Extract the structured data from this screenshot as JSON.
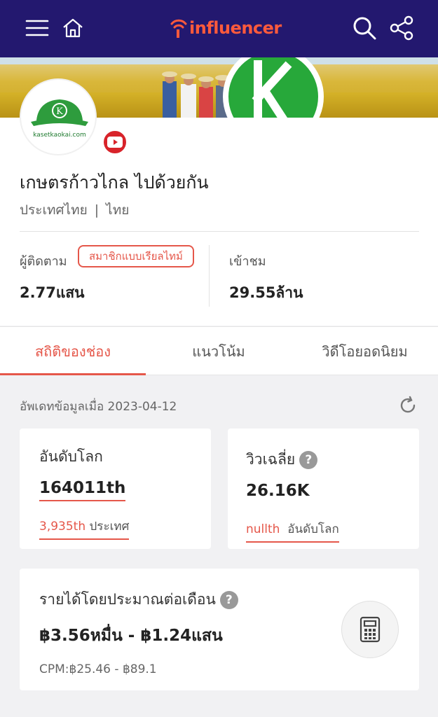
{
  "header": {
    "logo_text": "influencer",
    "brand_color": "#ff5a3c",
    "bar_color": "#23186f"
  },
  "channel": {
    "avatar_caption": "kasetkaokai.com",
    "platform_icon": "youtube-icon",
    "name": "เกษตรก้าวไกล ไปด้วยกัน",
    "country": "ประเทศไทย",
    "separator": "|",
    "language": "ไทย"
  },
  "stats": {
    "followers_label": "ผู้ติดตาม",
    "realtime_badge": "สมาชิกแบบเรียลไทม์",
    "followers_value": "2.77แสน",
    "views_label": "เข้าชม",
    "views_value": "29.55ล้าน"
  },
  "tabs": [
    {
      "label": "สถิติของช่อง",
      "active": true
    },
    {
      "label": "แนวโน้ม",
      "active": false
    },
    {
      "label": "วิดีโอยอดนิยม",
      "active": false
    }
  ],
  "updated_text": "อัพเดทข้อมูลเมื่อ 2023-04-12",
  "world_rank": {
    "title": "อันดับโลก",
    "value": "164011th",
    "country_rank": "3,935th",
    "country_rank_label": "ประเทศ"
  },
  "avg_views": {
    "title": "วิวเฉลี่ย",
    "help": "?",
    "value": "26.16K",
    "rank": "nullth",
    "rank_label": "อันดับโลก"
  },
  "income": {
    "title": "รายได้โดยประมาณต่อเดือน",
    "help": "?",
    "value": "฿3.56หมื่น - ฿1.24แสน",
    "cpm": "CPM:฿25.46 - ฿89.1"
  },
  "accent_color": "#e5574a"
}
